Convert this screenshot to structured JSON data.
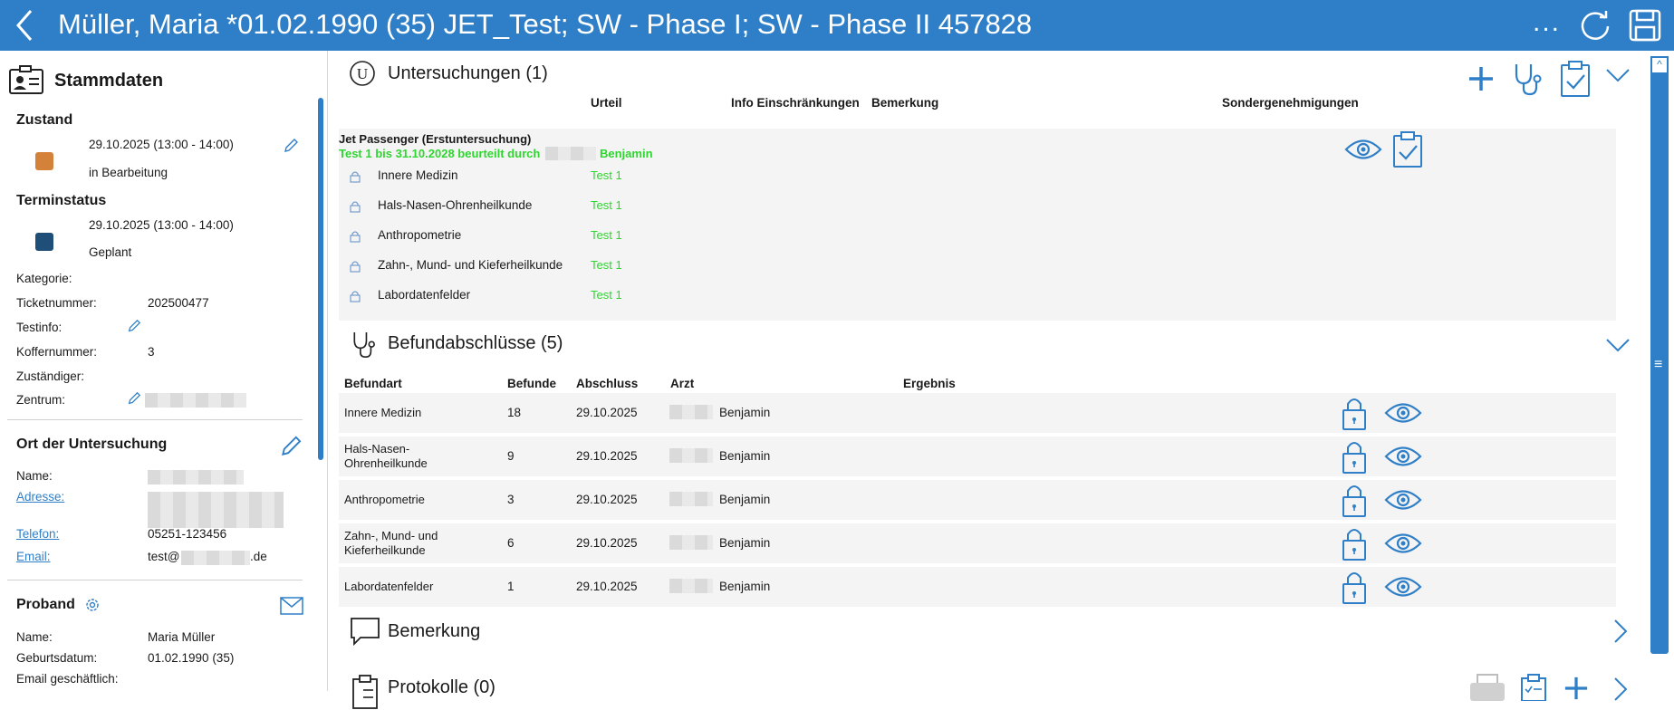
{
  "titlebar": {
    "title": "Müller, Maria *01.02.1990 (35) JET_Test; SW - Phase I; SW - Phase II 457828",
    "more_label": "...",
    "back_icon": "back-arrow-icon",
    "refresh_icon": "refresh-icon",
    "save_icon": "save-disk-icon"
  },
  "sidebar": {
    "header": "Stammdaten",
    "zustand": {
      "heading": "Zustand",
      "time": "29.10.2025 (13:00 - 14:00)",
      "status": "in Bearbeitung",
      "color": "#d4823a"
    },
    "terminstatus": {
      "heading": "Terminstatus",
      "time": "29.10.2025 (13:00 - 14:00)",
      "status": "Geplant",
      "color": "#1f4e79"
    },
    "fields": {
      "kategorie": "Kategorie:",
      "ticket_label": "Ticketnummer:",
      "ticket_value": "202500477",
      "testinfo": "Testinfo:",
      "koffer_label": "Koffernummer:",
      "koffer_value": "3",
      "zustaendiger": "Zuständiger:",
      "zentrum": "Zentrum:"
    },
    "ort": {
      "heading": "Ort der Untersuchung",
      "name_label": "Name:",
      "adresse_label": "Adresse:",
      "telefon_label": "Telefon:",
      "telefon_value": "05251-123456",
      "email_label": "Email:",
      "email_prefix": "test@",
      "email_suffix": ".de"
    },
    "proband": {
      "heading": "Proband",
      "name_label": "Name:",
      "name_value": "Maria Müller",
      "geb_label": "Geburtsdatum:",
      "geb_value": "01.02.1990 (35)",
      "email_label": "Email geschäftlich:"
    }
  },
  "untersuchungen": {
    "title": "Untersuchungen (1)",
    "columns": [
      "Urteil",
      "Info Einschränkungen",
      "Bemerkung",
      "Sondergenehmigungen"
    ],
    "exam_name": "Jet Passenger (Erstuntersuchung)",
    "verdict": "Test 1 bis 31.10.2028 beurteilt durch",
    "verdict_doctor": "Benjamin",
    "items": [
      {
        "name": "Innere Medizin",
        "result": "Test 1"
      },
      {
        "name": "Hals-Nasen-Ohrenheilkunde",
        "result": "Test 1"
      },
      {
        "name": "Anthropometrie",
        "result": "Test 1"
      },
      {
        "name": "Zahn-, Mund- und Kieferheilkunde",
        "result": "Test 1"
      },
      {
        "name": "Labordatenfelder",
        "result": "Test 1"
      }
    ]
  },
  "befund": {
    "title": "Befundabschlüsse (5)",
    "columns": [
      "Befundart",
      "Befunde",
      "Abschluss",
      "Arzt",
      "Ergebnis"
    ],
    "rows": [
      {
        "art": "Innere Medizin",
        "art2": "",
        "count": "18",
        "date": "29.10.2025",
        "arzt": "Benjamin"
      },
      {
        "art": "Hals-Nasen-",
        "art2": "Ohrenheilkunde",
        "count": "9",
        "date": "29.10.2025",
        "arzt": "Benjamin"
      },
      {
        "art": "Anthropometrie",
        "art2": "",
        "count": "3",
        "date": "29.10.2025",
        "arzt": "Benjamin"
      },
      {
        "art": "Zahn-, Mund- und",
        "art2": "Kieferheilkunde",
        "count": "6",
        "date": "29.10.2025",
        "arzt": "Benjamin"
      },
      {
        "art": "Labordatenfelder",
        "art2": "",
        "count": "1",
        "date": "29.10.2025",
        "arzt": "Benjamin"
      }
    ]
  },
  "bemerkung": {
    "title": "Bemerkung"
  },
  "protokolle": {
    "title": "Protokolle (0)"
  },
  "colors": {
    "accent": "#2f7fc8",
    "green": "#2fd62f",
    "row_bg": "#f4f4f4"
  },
  "scrollbar": {
    "up": "^",
    "grip": "≡"
  }
}
